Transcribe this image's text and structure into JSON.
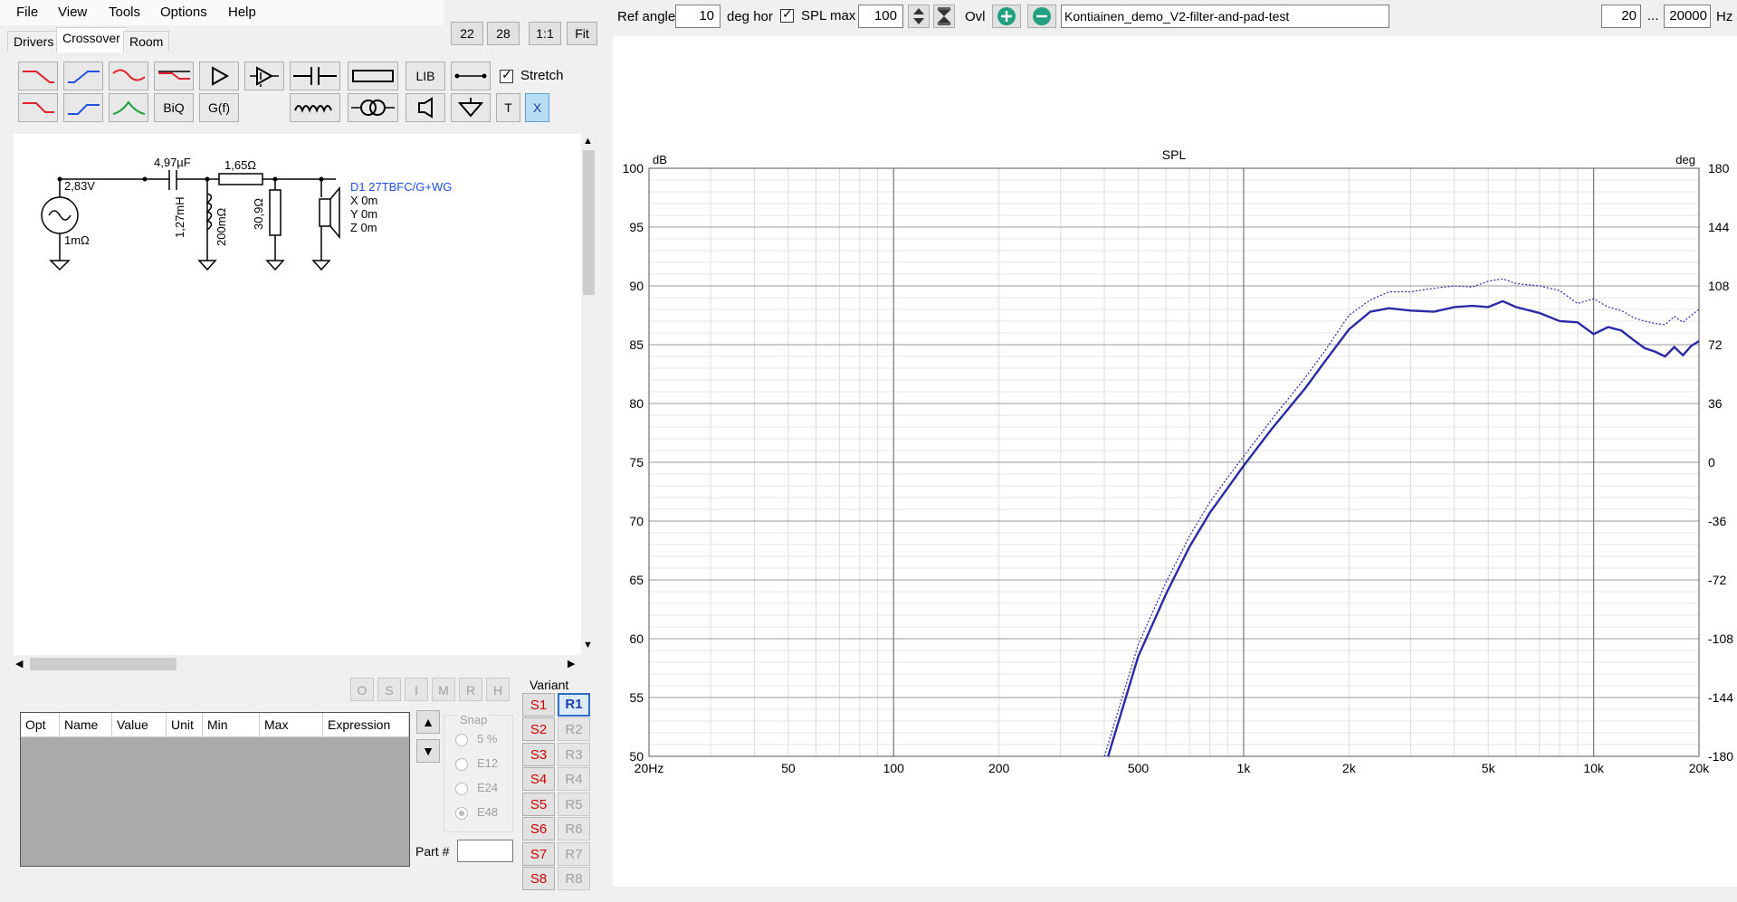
{
  "menu": [
    "File",
    "View",
    "Tools",
    "Options",
    "Help"
  ],
  "tabs": [
    "Drivers",
    "Crossover",
    "Room"
  ],
  "view_buttons": [
    "22",
    "28",
    "1:1",
    "Fit"
  ],
  "toolbar": {
    "lib_label": "LIB",
    "biq_label": "BiQ",
    "gf_label": "G(f)",
    "t_label": "T",
    "x_label": "X",
    "stretch_label": "Stretch",
    "stretch_checked": true
  },
  "schematic": {
    "source_voltage": "2,83V",
    "source_resistance": "1mΩ",
    "capacitor": "4,97µF",
    "inductor": "1,27mH",
    "inductor_resistance": "200mΩ",
    "series_resistor": "1,65Ω",
    "shunt_resistor": "30,9Ω",
    "driver_name": "D1 27TBFC/G+WG",
    "driver_x": "X 0m",
    "driver_y": "Y 0m",
    "driver_z": "Z 0m"
  },
  "opt_buttons": [
    "O",
    "S",
    "I",
    "M",
    "R",
    "H"
  ],
  "opt_table_headers": [
    "Opt",
    "Name",
    "Value",
    "Unit",
    "Min",
    "Max",
    "Expression"
  ],
  "snap": {
    "label": "Snap",
    "options": [
      "5 %",
      "E12",
      "E24",
      "E48"
    ],
    "selected": "E48"
  },
  "part_label": "Part #",
  "variant": {
    "label": "Variant",
    "s_labels": [
      "S1",
      "S2",
      "S3",
      "S4",
      "S5",
      "S6",
      "S7",
      "S8"
    ],
    "r_labels": [
      "R1",
      "R2",
      "R3",
      "R4",
      "R5",
      "R6",
      "R7",
      "R8"
    ],
    "selected_r": "R1"
  },
  "top_controls": {
    "ref_angle_label": "Ref angle",
    "ref_angle_value": "10",
    "deg_hor_label": "deg hor",
    "spl_max_label": "SPL max",
    "spl_max_checked": true,
    "spl_max_value": "100",
    "ovl_label": "Ovl",
    "overlay_name": "Kontiainen_demo_V2-filter-and-pad-test",
    "freq_min": "20",
    "freq_sep": "...",
    "freq_max": "20000",
    "hz_label": "Hz"
  },
  "colors": {
    "accent_red": "#e0202c",
    "accent_blue": "#2050e0",
    "accent_green": "#20a040",
    "trace": "#2a2aa8",
    "selected": "#2b6cc8"
  },
  "chart_data": {
    "type": "line",
    "title": "SPL",
    "ylabel": "dB",
    "y2label": "deg",
    "x_scale": "log",
    "xlim": [
      20,
      20000
    ],
    "ylim": [
      50,
      100
    ],
    "y2lim": [
      -180,
      180
    ],
    "x_ticks": [
      {
        "v": 20,
        "label": "20Hz"
      },
      {
        "v": 50,
        "label": "50"
      },
      {
        "v": 100,
        "label": "100"
      },
      {
        "v": 200,
        "label": "200"
      },
      {
        "v": 500,
        "label": "500"
      },
      {
        "v": 1000,
        "label": "1k"
      },
      {
        "v": 2000,
        "label": "2k"
      },
      {
        "v": 5000,
        "label": "5k"
      },
      {
        "v": 10000,
        "label": "10k"
      },
      {
        "v": 20000,
        "label": "20k"
      }
    ],
    "y_ticks": [
      100,
      95,
      90,
      85,
      80,
      75,
      70,
      65,
      60,
      55,
      50
    ],
    "y2_ticks": [
      "180",
      "144",
      "108",
      "72",
      "36",
      "0",
      "-36",
      "-72",
      "-108",
      "-144",
      "-180"
    ],
    "grid": true,
    "series": [
      {
        "style": "solid",
        "x": [
          410,
          500,
          600,
          700,
          800,
          900,
          1000,
          1200,
          1500,
          1700,
          2000,
          2300,
          2600,
          3000,
          3500,
          4000,
          4500,
          5000,
          5500,
          6000,
          7000,
          8000,
          9000,
          10000,
          11000,
          12000,
          13000,
          14000,
          15000,
          16000,
          17000,
          18000,
          19000,
          20000
        ],
        "y": [
          50,
          58.5,
          63.8,
          67.8,
          70.7,
          72.8,
          74.7,
          77.8,
          81.3,
          83.5,
          86.3,
          87.8,
          88.1,
          87.9,
          87.8,
          88.2,
          88.3,
          88.2,
          88.7,
          88.2,
          87.7,
          87,
          86.9,
          85.9,
          86.5,
          86.2,
          85.4,
          84.7,
          84.4,
          84,
          84.8,
          84.1,
          84.9,
          85.3
        ]
      },
      {
        "style": "dotted",
        "x": [
          400,
          500,
          600,
          700,
          800,
          900,
          1000,
          1200,
          1500,
          1700,
          2000,
          2300,
          2600,
          3000,
          3500,
          4000,
          4500,
          5000,
          5500,
          6000,
          7000,
          8000,
          9000,
          10000,
          11000,
          12000,
          13000,
          14000,
          15000,
          16000,
          17000,
          18000,
          19000,
          20000
        ],
        "y": [
          50,
          59.5,
          64.8,
          68.7,
          71.6,
          73.7,
          75.5,
          78.6,
          82.2,
          84.4,
          87.5,
          88.8,
          89.5,
          89.5,
          89.8,
          90,
          89.9,
          90.4,
          90.6,
          90.2,
          90,
          89.6,
          88.5,
          88.9,
          88.2,
          87.9,
          87.3,
          87,
          86.8,
          86.7,
          87.4,
          86.9,
          87.5,
          88
        ]
      }
    ]
  }
}
